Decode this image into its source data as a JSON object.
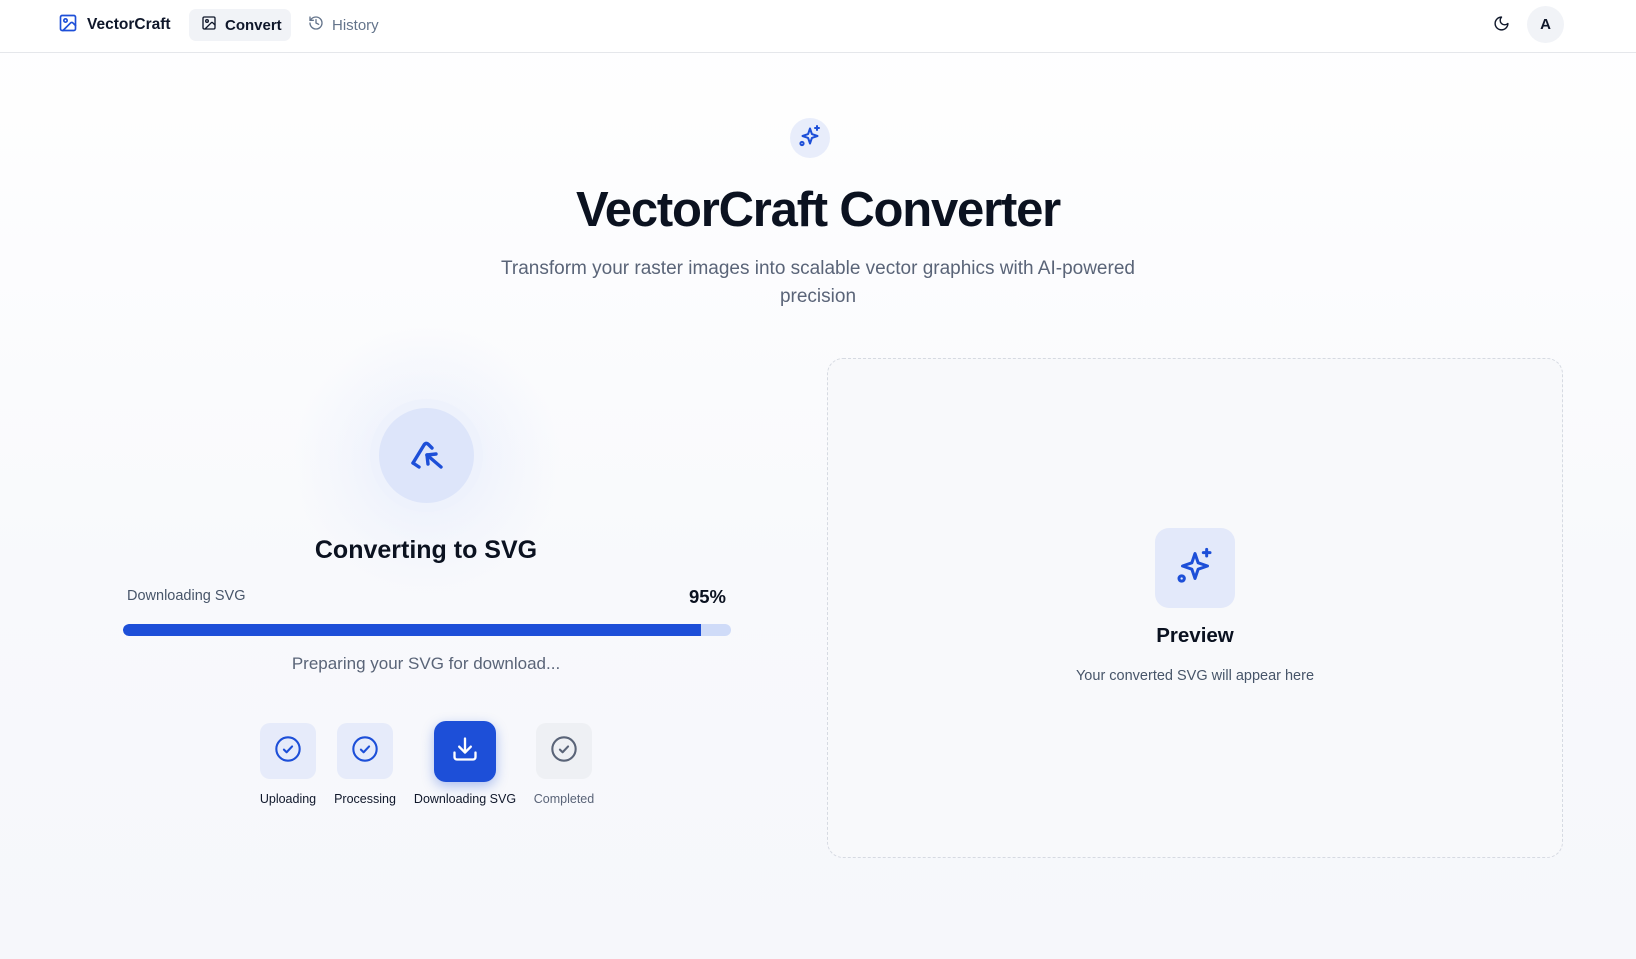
{
  "nav": {
    "brand": "VectorCraft",
    "tabs": [
      {
        "label": "Convert",
        "active": true,
        "icon": "image-icon"
      },
      {
        "label": "History",
        "active": false,
        "icon": "history-icon"
      }
    ],
    "theme_icon": "moon-icon",
    "avatar_initial": "A"
  },
  "hero": {
    "badge_icon": "sparkles-icon",
    "title": "VectorCraft Converter",
    "subtitle": "Transform your raster images into scalable vector graphics with AI-powered precision"
  },
  "progress": {
    "icon": "vector-pen-icon",
    "title": "Converting to SVG",
    "stage_label": "Downloading SVG",
    "percent_label": "95%",
    "percent": 95,
    "status": "Preparing your SVG for download..."
  },
  "steps": [
    {
      "label": "Uploading",
      "state": "done",
      "icon": "check-circle-icon"
    },
    {
      "label": "Processing",
      "state": "done",
      "icon": "check-circle-icon"
    },
    {
      "label": "Downloading SVG",
      "state": "active",
      "icon": "download-icon"
    },
    {
      "label": "Completed",
      "state": "pending",
      "icon": "check-circle-icon"
    }
  ],
  "preview": {
    "icon": "sparkles-icon",
    "title": "Preview",
    "subtitle": "Your converted SVG will appear here"
  },
  "colors": {
    "accent": "#1d4fd8",
    "accent_light": "#e3e9fa",
    "track": "#cfdbf8"
  }
}
